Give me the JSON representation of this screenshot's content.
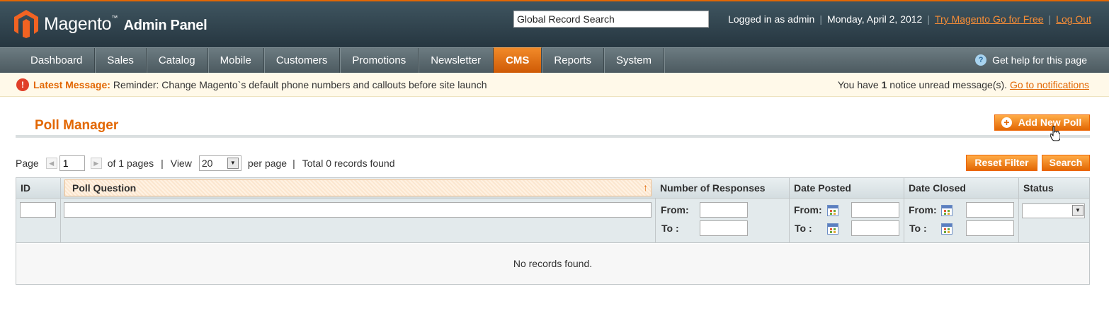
{
  "header": {
    "logo_main": "Magento",
    "logo_sub": "Admin Panel",
    "search_value": "Global Record Search",
    "logged_in": "Logged in as admin",
    "date": "Monday, April 2, 2012",
    "try_link": "Try Magento Go for Free",
    "logout_link": "Log Out"
  },
  "nav": {
    "items": [
      {
        "label": "Dashboard"
      },
      {
        "label": "Sales"
      },
      {
        "label": "Catalog"
      },
      {
        "label": "Mobile"
      },
      {
        "label": "Customers"
      },
      {
        "label": "Promotions"
      },
      {
        "label": "Newsletter"
      },
      {
        "label": "CMS",
        "active": true
      },
      {
        "label": "Reports"
      },
      {
        "label": "System"
      }
    ],
    "help": "Get help for this page"
  },
  "notice": {
    "label": "Latest Message:",
    "message": "Reminder: Change Magento`s default phone numbers and callouts before site launch",
    "right_prefix": "You have",
    "count": "1",
    "right_suffix": "notice unread message(s).",
    "link": "Go to notifications"
  },
  "page": {
    "title": "Poll Manager",
    "add_button": "Add New Poll",
    "reset_button": "Reset Filter",
    "search_button": "Search"
  },
  "pager": {
    "page_label": "Page",
    "page_value": "1",
    "of_pages": "of 1 pages",
    "sep1": "|",
    "view_label": "View",
    "view_value": "20",
    "per_page": "per page",
    "sep2": "|",
    "total": "Total 0 records found"
  },
  "grid": {
    "columns": [
      "ID",
      "Poll Question",
      "Number of Responses",
      "Date Posted",
      "Date Closed",
      "Status"
    ],
    "from_label": "From:",
    "to_label": "To :",
    "empty": "No records found."
  },
  "colors": {
    "accent": "#e26703",
    "header_bg": "#2f424c",
    "nav_bg": "#5a686e"
  }
}
